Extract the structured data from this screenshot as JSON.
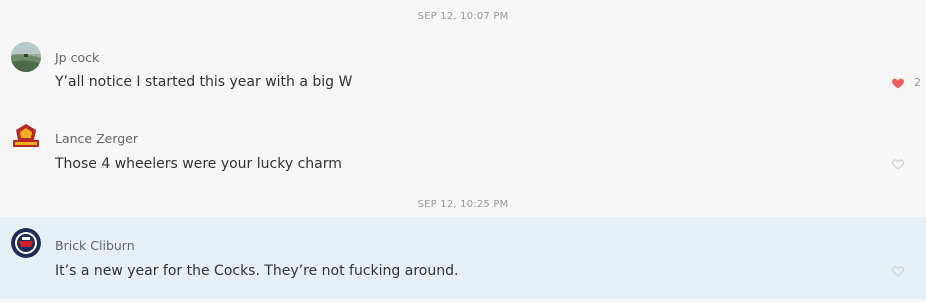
{
  "timestamps": [
    "SEP 12, 10:07 PM",
    "SEP 12, 10:25 PM"
  ],
  "messages": [
    {
      "sender": "Jp cock",
      "text": "Y’all notice I started this year with a big W",
      "liked": true,
      "like_count": "2",
      "avatar": "landscape-avatar"
    },
    {
      "sender": "Lance Zerger",
      "text": "Those 4 wheelers were your lucky charm",
      "liked": false,
      "like_count": "",
      "avatar": "team-logo-avatar"
    },
    {
      "sender": "Brick Cliburn",
      "text": "It’s a new year for the Cocks. They’re not fucking around.",
      "liked": false,
      "like_count": "",
      "avatar": "badge-logo-avatar"
    }
  ],
  "colors": {
    "background": "#f6f6f6",
    "highlight_row": "#e6eff6",
    "like_active": "#ef5b5b",
    "like_inactive": "#cfcfcf"
  }
}
